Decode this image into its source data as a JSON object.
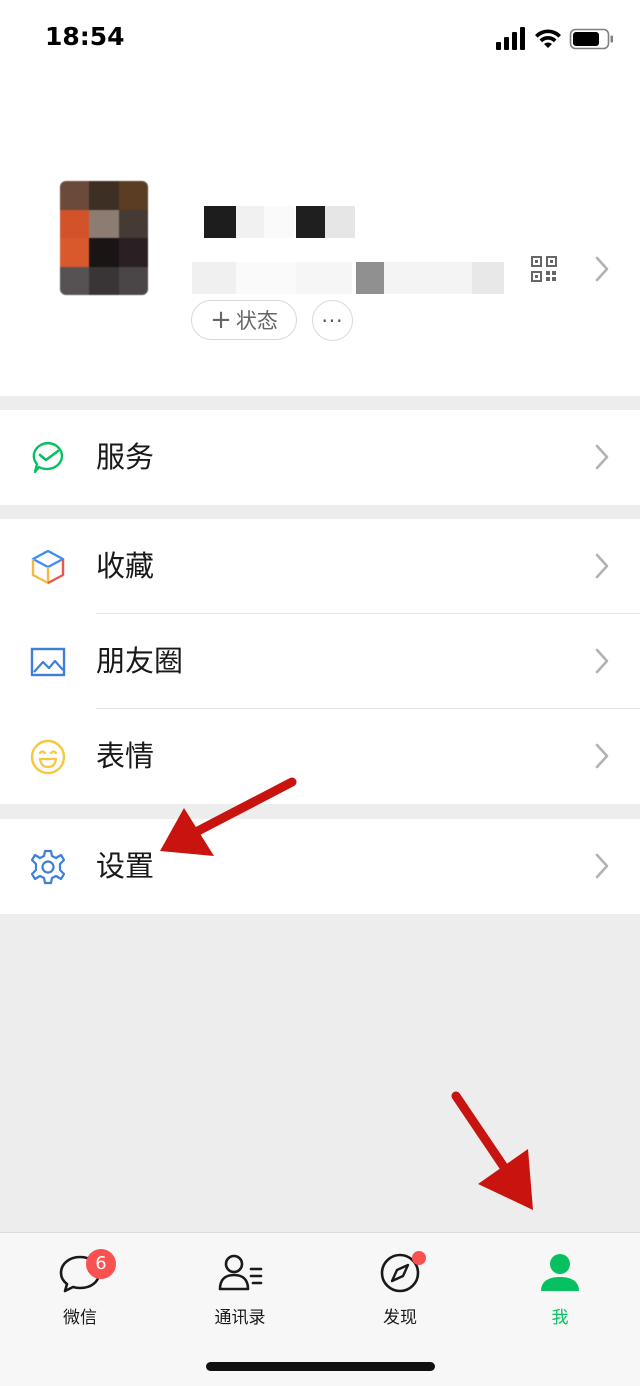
{
  "status_bar": {
    "time": "18:54"
  },
  "profile": {
    "status_button_label": "状态",
    "status_button_plus": "+",
    "more_label": "···"
  },
  "menu": {
    "services": "服务",
    "favorites": "收藏",
    "moments": "朋友圈",
    "stickers": "表情",
    "settings": "设置"
  },
  "tabbar": {
    "tabs": [
      {
        "label": "微信",
        "badge": "6"
      },
      {
        "label": "通讯录"
      },
      {
        "label": "发现",
        "dot": true
      },
      {
        "label": "我",
        "active": true
      }
    ]
  },
  "colors": {
    "accent_green": "#07c160",
    "badge_red": "#fa5151",
    "annotation_red": "#c8130f"
  }
}
